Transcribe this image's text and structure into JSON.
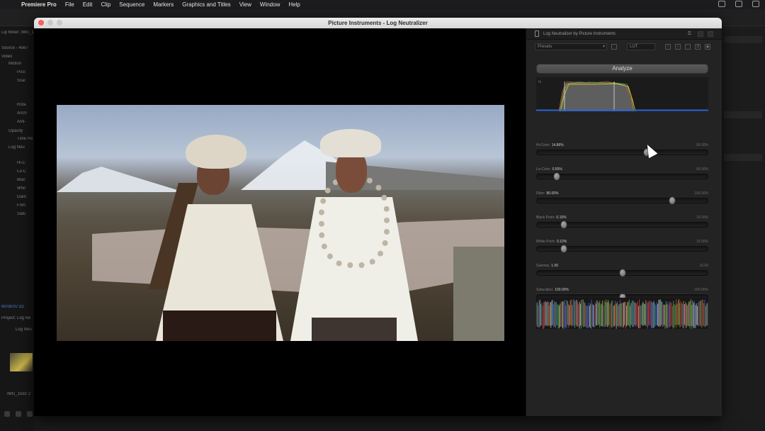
{
  "menubar": {
    "app": "Premiere Pro",
    "items": [
      "File",
      "Edit",
      "Clip",
      "Sequence",
      "Markers",
      "Graphics and Titles",
      "View",
      "Window",
      "Help"
    ]
  },
  "premiere": {
    "left_rows": [
      "Lip Mixer: IMG_1",
      "Source - 4567",
      "Video",
      "Motion",
      "Posi",
      "Scal",
      "",
      "Rota",
      "Anch",
      "Anti-",
      "Opacity",
      "Time Re",
      "Log Neu",
      "Hi-C",
      "Lo-C",
      "Blac",
      "Whit",
      "Gam",
      "Frim",
      "Satu"
    ],
    "timecode": "00:00:07:22",
    "project_tab": "Project: Log Ne",
    "project_item": "Log Neu",
    "clip_name": "IMG_1592 2"
  },
  "window": {
    "title": "Picture Instruments - Log Neutralizer"
  },
  "panel": {
    "header": "Log Neutralizer by Picture Instruments",
    "preset_placeholder": "Presets",
    "lut_label": "LUT",
    "analyze_label": "Analyze",
    "histogram_tag": "hi",
    "sliders": [
      {
        "name": "Hi-Color",
        "value": "14.86%",
        "max": "90.00%",
        "pos": 0.64
      },
      {
        "name": "Lo-Color",
        "value": "0.55%",
        "max": "90.00%",
        "pos": 0.12
      },
      {
        "name": "Filter",
        "value": "80.00%",
        "max": "100.00%",
        "pos": 0.79
      },
      {
        "name": "Black Point",
        "value": "0.10%",
        "max": "10.00%",
        "pos": 0.16
      },
      {
        "name": "White Point",
        "value": "0.10%",
        "max": "10.00%",
        "pos": 0.16
      },
      {
        "name": "Gamma",
        "value": "1.00",
        "max": "10.00",
        "pos": 0.5
      },
      {
        "name": "Saturation",
        "value": "100.00%",
        "max": "200.00%",
        "pos": 0.5
      }
    ]
  },
  "colors": {
    "accent_blue": "#2c64d6",
    "histogram_fill": "#5e5e5e"
  }
}
